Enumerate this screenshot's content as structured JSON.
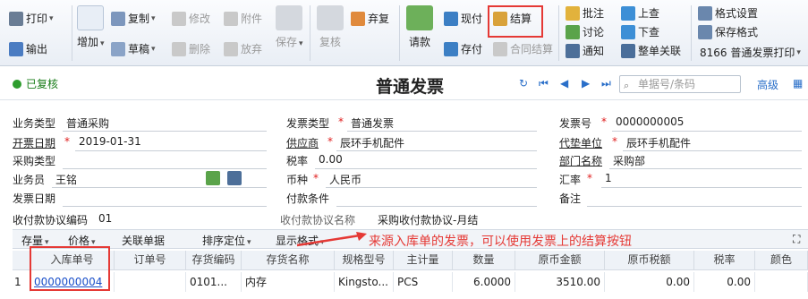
{
  "toolbar": {
    "print": "打印",
    "export": "输出",
    "add": "增加",
    "copy": "复制",
    "draft": "草稿",
    "modify": "修改",
    "delete": "删除",
    "attach": "附件",
    "discard": "放弃",
    "save": "保存",
    "review": "复核",
    "abandon_review": "弃复",
    "payment_request": "请款",
    "cash_pay": "现付",
    "settle": "结算",
    "save_pay": "存付",
    "contract_settle": "合同结算",
    "annotate": "批注",
    "discuss": "讨论",
    "notify": "通知",
    "prev_query": "上查",
    "next_query": "下查",
    "full_link": "整单关联",
    "format_settings": "格式设置",
    "save_format": "保存格式",
    "print_template": "8166 普通发票打印"
  },
  "header": {
    "status": "已复核",
    "title": "普通发票",
    "search_placeholder": "单据号/条码",
    "advanced": "高级"
  },
  "form": {
    "business_type_label": "业务类型",
    "business_type": "普通采购",
    "invoice_type_label": "发票类型",
    "invoice_type": "普通发票",
    "invoice_no_label": "发票号",
    "invoice_no": "0000000005",
    "invoice_date_label": "开票日期",
    "invoice_date": "2019-01-31",
    "supplier_label": "供应商",
    "supplier": "辰环手机配件",
    "payer_label": "代垫单位",
    "payer": "辰环手机配件",
    "purchase_type_label": "采购类型",
    "purchase_type": "",
    "tax_rate_label": "税率",
    "tax_rate": "0.00",
    "dept_label": "部门名称",
    "dept": "采购部",
    "staff_label": "业务员",
    "staff": "王铭",
    "currency_label": "币种",
    "currency": "人民币",
    "exchange_label": "汇率",
    "exchange": "1",
    "date_label": "发票日期",
    "pay_terms_label": "付款条件",
    "remark_label": "备注",
    "pay_agreement_code_label": "收付款协议编码",
    "pay_agreement_code": "01",
    "pay_agreement_name_label": "收付款协议名称",
    "pay_agreement_name": "采购收付款协议-月结"
  },
  "gridbar": {
    "stock": "存量",
    "price": "价格",
    "related": "关联单据",
    "sort": "排序定位",
    "display_format": "显示格式"
  },
  "annotation": "来源入库单的发票，可以使用发票上的结算按钮",
  "grid": {
    "columns": [
      "入库单号",
      "订单号",
      "存货编码",
      "存货名称",
      "规格型号",
      "主计量",
      "数量",
      "原币金额",
      "原币税额",
      "税率",
      "颜色"
    ],
    "rows": [
      {
        "idx": "1",
        "receipt_no": "0000000004",
        "order_no": "",
        "inv_code": "0101...",
        "inv_name": "内存",
        "spec": "Kingsto...",
        "unit": "PCS",
        "qty": "6.0000",
        "amount": "3510.00",
        "tax": "0.00",
        "rate": "0.00",
        "color": ""
      }
    ]
  },
  "colors": {
    "highlight": "#e53935",
    "link": "#1a4fc9",
    "status": "#1a7d1a"
  }
}
